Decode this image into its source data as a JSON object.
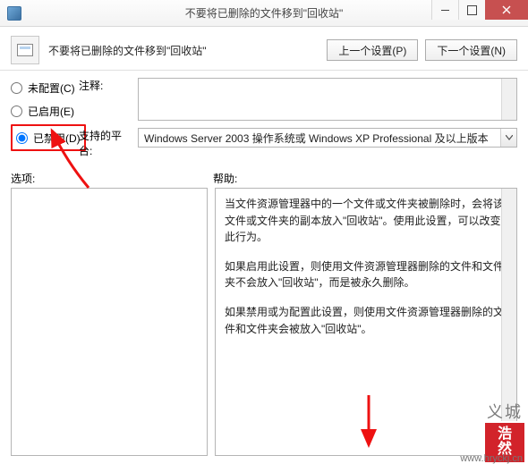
{
  "window": {
    "title": "不要将已删除的文件移到\"回收站\""
  },
  "header": {
    "heading": "不要将已删除的文件移到\"回收站\"",
    "prev_btn": "上一个设置(P)",
    "next_btn": "下一个设置(N)"
  },
  "radios": {
    "unconfigured": "未配置(C)",
    "enabled": "已启用(E)",
    "disabled": "已禁用(D)",
    "selected": "disabled"
  },
  "labels": {
    "comment": "注释:",
    "platform": "支持的平台:",
    "options": "选项:",
    "help": "帮助:"
  },
  "platform": {
    "value": "Windows Server 2003 操作系统或 Windows XP Professional 及以上版本"
  },
  "help": {
    "p1": "当文件资源管理器中的一个文件或文件夹被删除时，会将该文件或文件夹的副本放入\"回收站\"。使用此设置，可以改变此行为。",
    "p2": "如果启用此设置，则使用文件资源管理器删除的文件和文件夹不会放入\"回收站\"，而是被永久删除。",
    "p3": "如果禁用或为配置此设置，则使用文件资源管理器删除的文件和文件夹会被放入\"回收站\"。"
  },
  "watermark": {
    "line1": "浩",
    "line2": "然",
    "side": "义城",
    "url": "www.hryckj.cn"
  }
}
